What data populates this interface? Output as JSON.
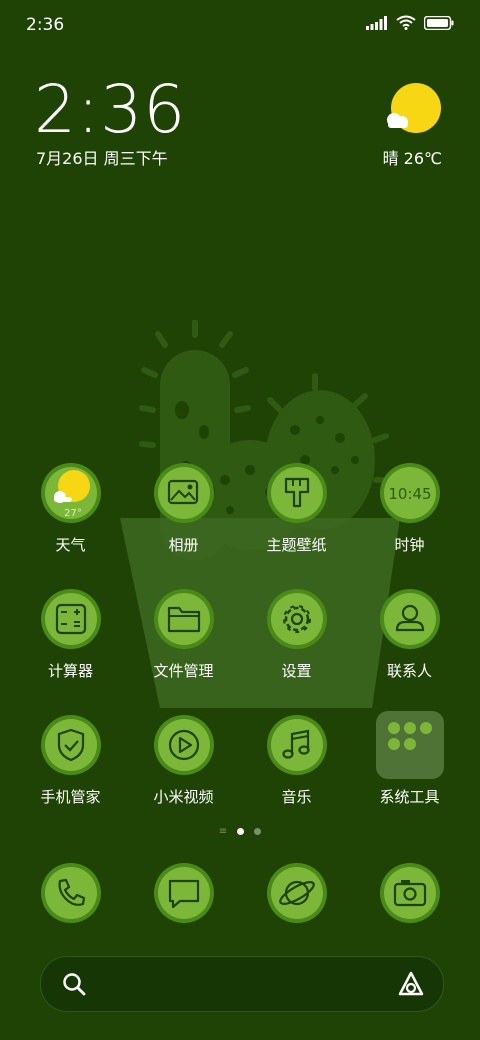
{
  "statusbar": {
    "time": "2:36"
  },
  "lockscreen": {
    "clock": "2:36",
    "date": "7月26日 周三下午",
    "weather": "晴 26℃"
  },
  "apps": [
    {
      "label": "天气",
      "icon": "weather-icon",
      "overlay": "27°"
    },
    {
      "label": "相册",
      "icon": "gallery-icon"
    },
    {
      "label": "主题壁纸",
      "icon": "theme-brush-icon"
    },
    {
      "label": "时钟",
      "icon": "clock-icon",
      "overlay": "10:45"
    },
    {
      "label": "计算器",
      "icon": "calculator-icon"
    },
    {
      "label": "文件管理",
      "icon": "folder-icon"
    },
    {
      "label": "设置",
      "icon": "gear-icon"
    },
    {
      "label": "联系人",
      "icon": "contact-icon"
    },
    {
      "label": "手机管家",
      "icon": "shield-icon"
    },
    {
      "label": "小米视频",
      "icon": "play-icon"
    },
    {
      "label": "音乐",
      "icon": "music-note-icon"
    },
    {
      "label": "系统工具",
      "icon": "folder-group-icon"
    }
  ],
  "dock": [
    {
      "icon": "phone-icon"
    },
    {
      "icon": "message-icon"
    },
    {
      "icon": "browser-planet-icon"
    },
    {
      "icon": "camera-icon"
    }
  ],
  "colors": {
    "background": "#1e4305",
    "icon_fill": "#7cb73a",
    "icon_dark": "#1e4305",
    "sun": "#f7d613"
  }
}
